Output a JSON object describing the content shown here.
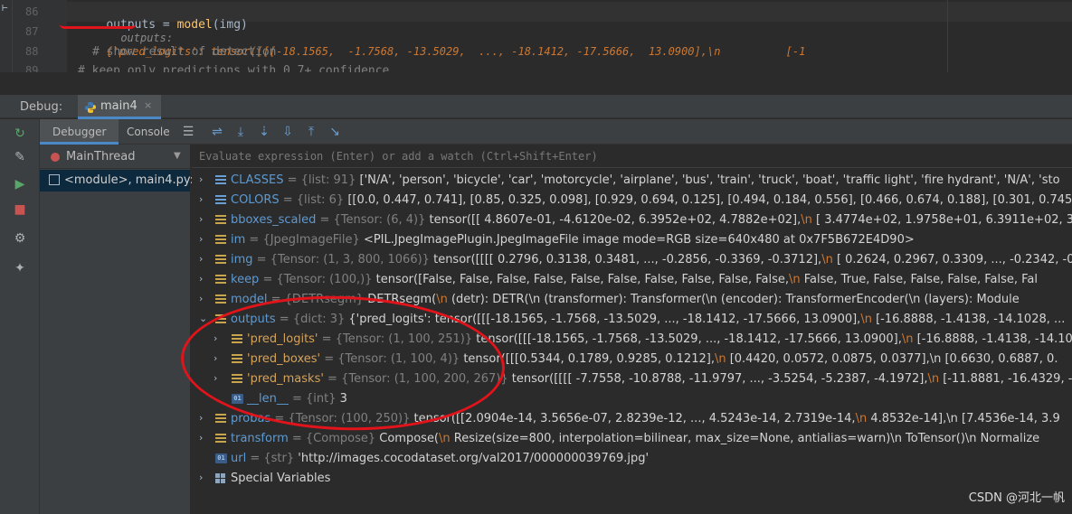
{
  "editor": {
    "lines": [
      {
        "num": "86",
        "code_var": "outputs",
        "code_eq": " = ",
        "code_fn": "model",
        "code_rest": "(img)",
        "inline_key": "outputs:",
        "inline_val": "{'pred_logits': tensor([[[-18.1565,  -1.7568, -13.5029,  ..., -18.1412, -17.5666,  13.0900],\\n          [-1"
      },
      {
        "num": "87",
        "code": ""
      },
      {
        "num": "88",
        "code": "# show result of detection"
      },
      {
        "num": "89",
        "code": "# keep only predictions with 0.7+ confidence"
      }
    ]
  },
  "debug": {
    "label": "Debug:",
    "tab_label": "main4",
    "tab_close": "×",
    "subtabs": [
      "Debugger",
      "Console"
    ],
    "thread": "MainThread",
    "frame": "<module>, main4.py:",
    "eval_placeholder": "Evaluate expression (Enter) or add a watch (Ctrl+Shift+Enter)"
  },
  "variables": [
    {
      "name": "CLASSES",
      "type": "{list: 91}",
      "value": "['N/A', 'person', 'bicycle', 'car', 'motorcycle', 'airplane', 'bus', 'train', 'truck', 'boat', 'traffic light', 'fire hydrant', 'N/A', 'sto"
    },
    {
      "name": "COLORS",
      "type": "{list: 6}",
      "value": "[[0.0, 0.447, 0.741], [0.85, 0.325, 0.098], [0.929, 0.694, 0.125], [0.494, 0.184, 0.556], [0.466, 0.674, 0.188], [0.301, 0.745, 0.933]]"
    },
    {
      "name": "bboxes_scaled",
      "type": "{Tensor: (6, 4)}",
      "value": "tensor([[ 4.8607e-01, -4.6120e-02,  6.3952e+02,  4.7882e+02],",
      "nl": "\\n",
      "tail": "      [ 3.4774e+02,  1.9758e+01,  6.3911e+02,  3.6"
    },
    {
      "name": "im",
      "type": "{JpegImageFile}",
      "value": "<PIL.JpegImagePlugin.JpegImageFile image mode=RGB size=640x480 at 0x7F5B672E4D90>"
    },
    {
      "name": "img",
      "type": "{Tensor: (1, 3, 800, 1066)}",
      "value": "tensor([[[[ 0.2796,  0.3138,  0.3481,  ..., -0.2856, -0.3369, -0.3712],",
      "nl": "\\n",
      "tail": "       [ 0.2624,  0.2967,  0.3309,  ..., -0.2342, -0."
    },
    {
      "name": "keep",
      "type": "{Tensor: (100,)}",
      "value": "tensor([False, False, False, False, False, False, False, False, False, False,",
      "nl": "\\n",
      "tail": "      False,  True, False, False, False, False, Fal"
    },
    {
      "name": "model",
      "type": "{DETRsegm}",
      "value": "DETRsegm(",
      "nl": "\\n",
      "tail": " (detr): DETR(\\n  (transformer): Transformer(\\n    (encoder): TransformerEncoder(\\n      (layers): Module"
    },
    {
      "name": "outputs",
      "type": "{dict: 3}",
      "value": "{'pred_logits': tensor([[[-18.1565,  -1.7568, -13.5029,  ..., -18.1412, -17.5666,  13.0900],",
      "nl": "\\n",
      "tail": "      [-16.8888,  -1.4138, -14.1028,  ..."
    },
    {
      "name": "'pred_logits'",
      "type": "{Tensor: (1, 100, 251)}",
      "value": "tensor([[[-18.1565,  -1.7568, -13.5029,  ..., -18.1412, -17.5666,  13.0900],",
      "nl": "\\n",
      "tail": "      [-16.8888,  -1.4138, -14.10"
    },
    {
      "name": "'pred_boxes'",
      "type": "{Tensor: (1, 100, 4)}",
      "value": "tensor([[[0.5344, 0.1789, 0.9285, 0.1212],",
      "nl": "\\n",
      "tail": "      [0.4420, 0.0572, 0.0875, 0.0377],\\n      [0.6630, 0.6887, 0."
    },
    {
      "name": "'pred_masks'",
      "type": "{Tensor: (1, 100, 200, 267)}",
      "value": "tensor([[[[ -7.7558, -10.8788, -11.9797,  ...,  -3.5254,  -5.2387,  -4.1972],",
      "nl": "\\n",
      "tail": "      [-11.8881, -16.4329, -"
    },
    {
      "name": "__len__",
      "type": "{int}",
      "value": "3"
    },
    {
      "name": "probas",
      "type": "{Tensor: (100, 250)}",
      "value": "tensor([[2.0904e-14, 3.5656e-07, 2.8239e-12,  ..., 4.5243e-14, 2.7319e-14,",
      "nl": "\\n",
      "tail": "      4.8532e-14],\\n      [7.4536e-14, 3.9"
    },
    {
      "name": "transform",
      "type": "{Compose}",
      "value": "Compose(",
      "nl": "\\n",
      "tail": "   Resize(size=800, interpolation=bilinear, max_size=None, antialias=warn)\\n   ToTensor()\\n   Normalize"
    },
    {
      "name": "url",
      "type": "{str}",
      "value": "'http://images.cocodataset.org/val2017/000000039769.jpg'"
    },
    {
      "name": "Special Variables",
      "type": "",
      "value": ""
    }
  ],
  "watermark": "CSDN @河北一帆",
  "icons": {
    "resume": "resume-icon",
    "stop": "stop-icon",
    "settings": "settings-icon",
    "pin": "pin-icon"
  },
  "colors": {
    "accent": "#4a88c7",
    "annotation": "#e0141a",
    "value_keyword": "#cc7832",
    "var_name": "#5d9ad2"
  }
}
